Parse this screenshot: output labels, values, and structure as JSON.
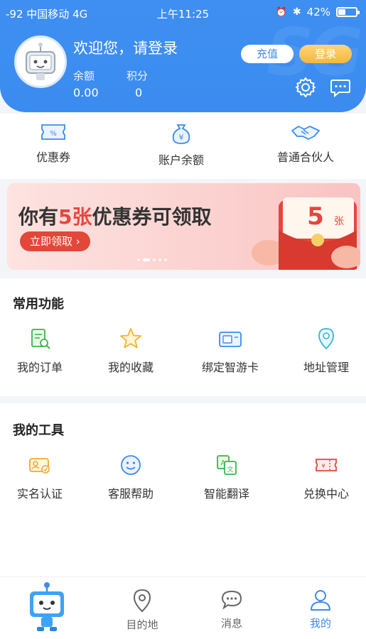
{
  "status_bar": {
    "signal": "-92",
    "carrier": "中国移动",
    "network": "4G",
    "time": "上午11:25",
    "battery": "42%",
    "battery_level": 0.42
  },
  "header": {
    "welcome": "欢迎您，请登录",
    "balance_label": "余额",
    "balance_value": "0.00",
    "points_label": "积分",
    "points_value": "0",
    "recharge_button": "充值",
    "login_button": "登录",
    "icons": [
      "gear-icon",
      "message-icon"
    ]
  },
  "quick_links": [
    {
      "label": "优惠券",
      "icon": "coupon-icon"
    },
    {
      "label": "账户余额",
      "icon": "money-bag-icon"
    },
    {
      "label": "普通合伙人",
      "icon": "handshake-icon"
    }
  ],
  "banner": {
    "title_prefix": "你有",
    "title_highlight": "5张",
    "title_suffix": "优惠券可领取",
    "button": "立即领取 ›",
    "envelope_number": "5",
    "envelope_unit": "张"
  },
  "common_functions": {
    "title": "常用功能",
    "items": [
      {
        "label": "我的订单",
        "icon": "order-icon"
      },
      {
        "label": "我的收藏",
        "icon": "star-icon"
      },
      {
        "label": "绑定智游卡",
        "icon": "card-icon"
      },
      {
        "label": "地址管理",
        "icon": "location-icon"
      }
    ]
  },
  "my_tools": {
    "title": "我的工具",
    "items": [
      {
        "label": "实名认证",
        "icon": "id-card-icon"
      },
      {
        "label": "客服帮助",
        "icon": "smile-icon"
      },
      {
        "label": "智能翻译",
        "icon": "translate-icon"
      },
      {
        "label": "兑换中心",
        "icon": "ticket-icon"
      }
    ]
  },
  "tabbar": {
    "items": [
      {
        "label": "",
        "icon": "robot-mascot-icon"
      },
      {
        "label": "目的地",
        "icon": "map-pin-icon"
      },
      {
        "label": "消息",
        "icon": "chat-icon"
      },
      {
        "label": "我的",
        "icon": "user-icon",
        "active": true
      }
    ]
  },
  "colors": {
    "primary": "#3b8cf0",
    "gold": "#f4b73f",
    "red": "#e3473a"
  }
}
